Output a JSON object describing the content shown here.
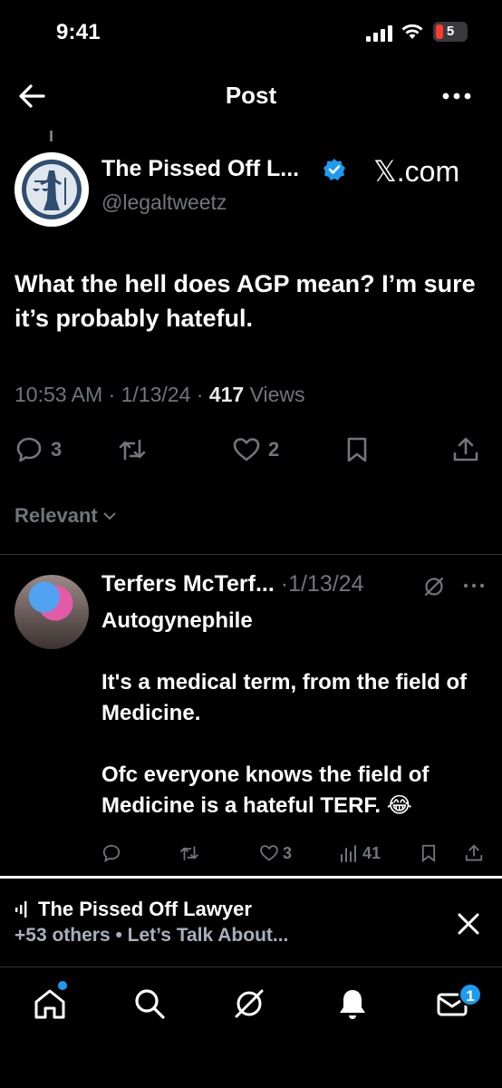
{
  "status_bar": {
    "time": "9:41",
    "battery": "5"
  },
  "header": {
    "title": "Post"
  },
  "post": {
    "author_name": "The Pissed Off L...",
    "author_handle": "@legaltweetz",
    "watermark": "𝕏.com",
    "text": "What the hell does AGP mean? I’m sure it’s probably hateful.",
    "time": "10:53 AM",
    "date": "1/13/24",
    "views_count": "417",
    "views_label": "Views",
    "replies": "3",
    "likes": "2"
  },
  "sort": {
    "label": "Relevant"
  },
  "reply": {
    "author_name": "Terfers McTerf...",
    "date": "·1/13/24",
    "paragraphs": [
      "Autogynephile",
      "It's a medical term, from the field of Medicine.",
      "Ofc everyone knows the field of Medicine is a hateful TERF. 😂"
    ],
    "likes": "3",
    "views": "41"
  },
  "space": {
    "title": "The Pissed Off Lawyer",
    "subtitle": "+53 others • Let’s Talk About..."
  },
  "nav": {
    "messages_badge": "1"
  },
  "colors": {
    "accent": "#1d9bf0",
    "muted": "#71767b",
    "background": "#000000"
  }
}
